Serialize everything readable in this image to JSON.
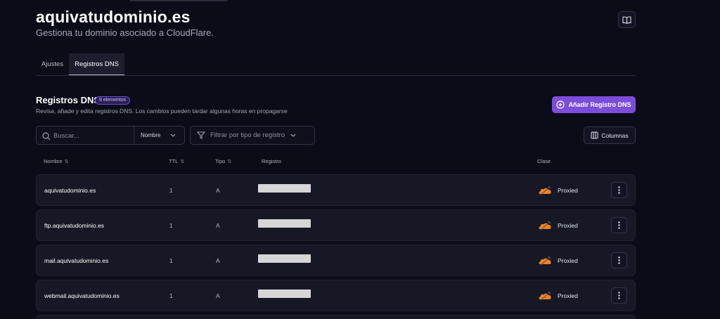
{
  "header": {
    "domain_title": "aquivatudominio.es",
    "subtitle": "Gestiona tu dominio asociado a CloudFlare."
  },
  "tabs": [
    {
      "label": "Ajustes",
      "active": false
    },
    {
      "label": "Registros DNS",
      "active": true
    }
  ],
  "dns_section": {
    "title": "Registros DNS",
    "count_badge": "9 elementos",
    "description": "Revisa, añade y edita registros DNS. Los cambios pueden tardar algunas horas en propagarse",
    "add_button_label": "Añadir Registro DNS"
  },
  "toolbar": {
    "search_placeholder": "Buscar...",
    "search_field": "Nombre",
    "filter_placeholder": "Filtrar por tipo de registro",
    "columns_label": "Columnas"
  },
  "table": {
    "headers": {
      "name": "Nombre",
      "ttl": "TTL",
      "type": "Tipo",
      "record": "Registro",
      "class": "Clase"
    },
    "rows": [
      {
        "name": "aquivatudominio.es",
        "ttl": "1",
        "type": "A",
        "class": "Proxied"
      },
      {
        "name": "ftp.aquivatudominio.es",
        "ttl": "1",
        "type": "A",
        "class": "Proxied"
      },
      {
        "name": "mail.aquivatudominio.es",
        "ttl": "1",
        "type": "A",
        "class": "Proxied"
      },
      {
        "name": "webmail.aquivatudominio.es",
        "ttl": "1",
        "type": "A",
        "class": "Proxied"
      }
    ]
  },
  "colors": {
    "background": "#0b0c17",
    "accent": "#7c4ddb",
    "cloudflare_orange": "#f48120",
    "row_background": "#161826"
  },
  "icons": {
    "docs": "book-open-icon",
    "search": "search-icon",
    "filter": "filter-icon",
    "columns": "columns-icon",
    "add": "plus-circle-icon",
    "proxied": "cloudflare-cloud-icon",
    "row_menu": "more-vertical-icon"
  }
}
